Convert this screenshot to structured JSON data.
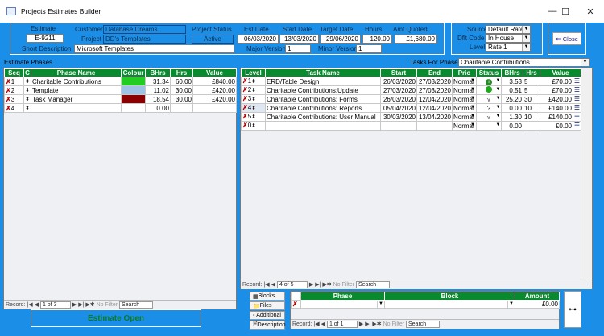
{
  "window": {
    "title": "Projects Estimates Builder",
    "minimize": "—",
    "maximize": "☐",
    "close": "✕"
  },
  "header": {
    "estimate_label": "Estimate",
    "estimate": "E-9211",
    "customer_label": "Customer",
    "customer": "Database Dreams",
    "project_label": "Project",
    "project": "DD's Templates",
    "short_desc_label": "Short Description",
    "short_desc": "Microsoft Templates",
    "status_label": "Project Status",
    "status": "Active",
    "est_date_label": "Est Date",
    "est_date": "06/03/2020",
    "start_date_label": "Start Date",
    "start_date": "13/03/2020",
    "target_date_label": "Target Date",
    "target_date": "29/06/2020",
    "hours_label": "Hours",
    "hours": "120.00",
    "amt_label": "Amt Quoted",
    "amt": "£1,680.00",
    "major_label": "Major Version",
    "major": "1",
    "minor_label": "Minor Version",
    "minor": "1"
  },
  "source": {
    "source_label": "Source",
    "source": "Default Rate",
    "code_label": "Dflt Code",
    "code": "In House",
    "level_label": "Level",
    "level": "Rate 1"
  },
  "close_label": "Close",
  "phases": {
    "title": "Estimate Phases",
    "headers": [
      "Seq",
      "C",
      "Phase Name",
      "Colour",
      "BHrs",
      "Hrs",
      "Value"
    ],
    "rows": [
      {
        "seq": "1",
        "name": "Charitable Contributions",
        "color": "#22cc22",
        "bhrs": "31.34",
        "hrs": "60.00",
        "value": "£840.00"
      },
      {
        "seq": "2",
        "name": "Template",
        "color": "#9dc3e6",
        "bhrs": "11.02",
        "hrs": "30.00",
        "value": "£420.00"
      },
      {
        "seq": "3",
        "name": "Task Manager",
        "color": "#8b0000",
        "bhrs": "18.54",
        "hrs": "30.00",
        "value": "£420.00"
      },
      {
        "seq": "4",
        "name": "",
        "color": "",
        "bhrs": "0.00",
        "hrs": "",
        "value": ""
      }
    ],
    "nav": {
      "record": "Record:",
      "pos": "1 of 3",
      "nofilter": "No Filter",
      "search": "Search"
    }
  },
  "tasks": {
    "for_phase_label": "Tasks For Phase",
    "for_phase": "Charitable Contributions",
    "headers": [
      "Level",
      "Task Name",
      "Start",
      "End",
      "Prio",
      "Status",
      "BHrs",
      "Hrs",
      "Value"
    ],
    "rows": [
      {
        "level": "1",
        "name": "ERD/Table Design",
        "start": "26/03/2020",
        "end": "27/03/2020",
        "prio": "Normal",
        "status": "info",
        "bhrs": "3.53",
        "hrs": "5",
        "value": "£70.00"
      },
      {
        "level": "2",
        "name": "Charitable Contributions:Update",
        "start": "27/03/2020",
        "end": "27/03/2020",
        "prio": "Normal",
        "status": "dot",
        "bhrs": "0.51",
        "hrs": "5",
        "value": "£70.00"
      },
      {
        "level": "3",
        "name": "Charitable Contributions: Forms",
        "start": "26/03/2020",
        "end": "12/04/2020",
        "prio": "Normal",
        "status": "√",
        "bhrs": "25.20",
        "hrs": "30",
        "value": "£420.00"
      },
      {
        "level": "4",
        "name": "Charitable Contributions: Reports",
        "start": "05/04/2020",
        "end": "12/04/2020",
        "prio": "Normal",
        "status": "?",
        "bhrs": "0.00",
        "hrs": "10",
        "value": "£140.00"
      },
      {
        "level": "5",
        "name": "Charitable Contributions: User Manual",
        "start": "30/03/2020",
        "end": "13/04/2020",
        "prio": "Normal",
        "status": "√",
        "bhrs": "1.30",
        "hrs": "10",
        "value": "£140.00"
      },
      {
        "level": "0",
        "name": "",
        "start": "",
        "end": "",
        "prio": "Normal",
        "status": "",
        "bhrs": "0.00",
        "hrs": "",
        "value": "£0.00"
      }
    ],
    "nav": {
      "record": "Record:",
      "pos": "4 of 5",
      "nofilter": "No Filter",
      "search": "Search"
    }
  },
  "side_buttons": [
    "Blocks",
    "Files",
    "Additional",
    "Description"
  ],
  "blocks": {
    "headers": [
      "Phase",
      "Block",
      "Amount"
    ],
    "amount": "£0.00",
    "nav": {
      "record": "Record:",
      "pos": "1 of 1",
      "nofilter": "No Filter",
      "search": "Search"
    }
  },
  "estimate_status": "Estimate Open"
}
